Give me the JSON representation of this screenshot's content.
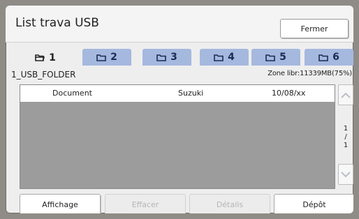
{
  "title": "List trava USB",
  "close_label": "Fermer",
  "tabs": [
    {
      "label": "1",
      "active": true
    },
    {
      "label": "2",
      "active": false
    },
    {
      "label": "3",
      "active": false
    },
    {
      "label": "4",
      "active": false
    },
    {
      "label": "5",
      "active": false
    },
    {
      "label": "6",
      "active": false
    }
  ],
  "folder_name": "1_USB_FOLDER",
  "free_space": "Zone libr:11339MB(75%)",
  "rows": [
    {
      "document": "Document",
      "owner": "Suzuki",
      "date": "10/08/xx"
    }
  ],
  "pager": {
    "current": "1",
    "sep": "/",
    "total": "1"
  },
  "buttons": {
    "view": "Affichage",
    "delete": "Effacer",
    "details": "Détails",
    "deposit": "Dépôt"
  },
  "colors": {
    "tab_bg": "#a5b8de",
    "list_bg": "#9c9c9c"
  }
}
